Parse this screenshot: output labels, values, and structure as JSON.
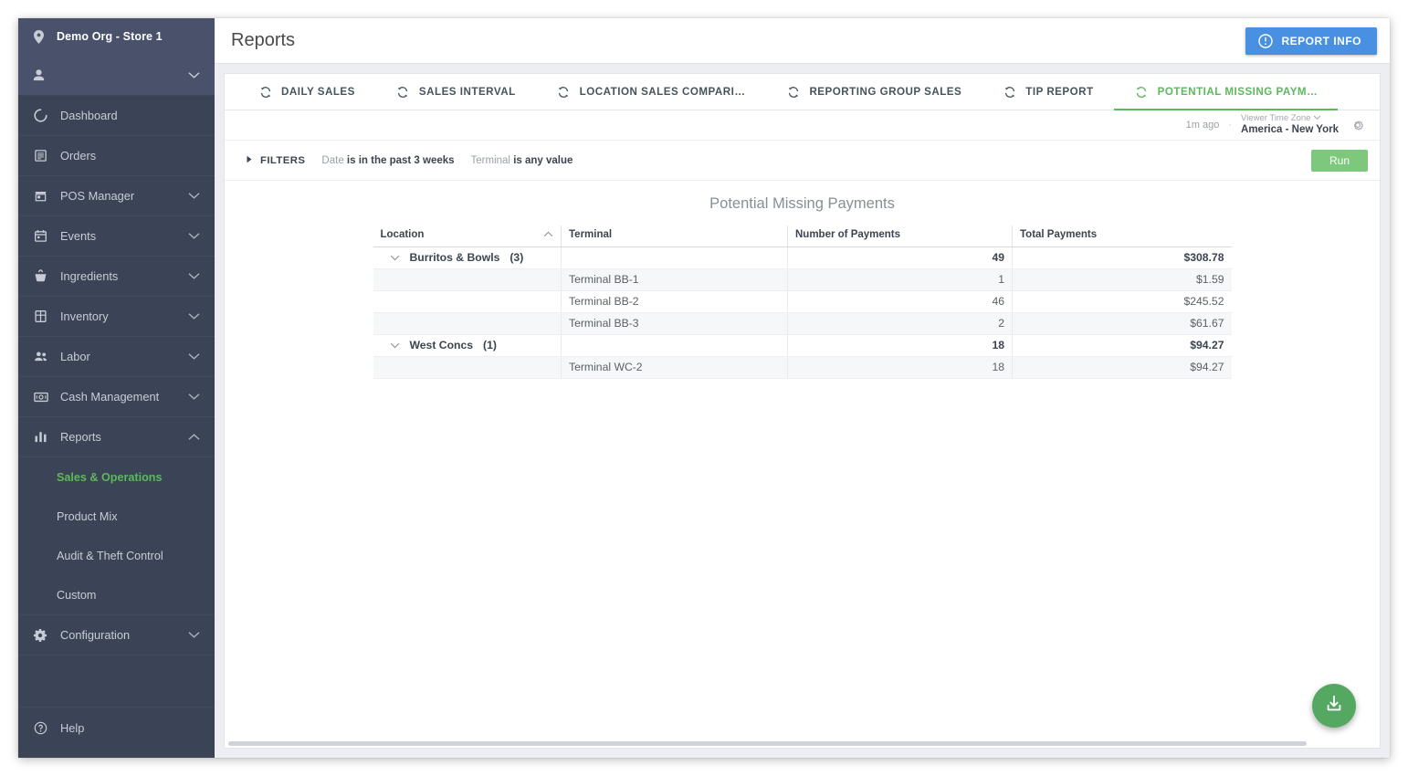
{
  "sidebar": {
    "org_name": "Demo Org - Store 1",
    "items": [
      {
        "label": "Dashboard",
        "icon": "dashboard-icon",
        "expandable": false
      },
      {
        "label": "Orders",
        "icon": "orders-icon",
        "expandable": false
      },
      {
        "label": "POS Manager",
        "icon": "pos-manager-icon",
        "expandable": true
      },
      {
        "label": "Events",
        "icon": "events-calendar-icon",
        "expandable": true
      },
      {
        "label": "Ingredients",
        "icon": "ingredients-icon",
        "expandable": true
      },
      {
        "label": "Inventory",
        "icon": "inventory-icon",
        "expandable": true
      },
      {
        "label": "Labor",
        "icon": "labor-people-icon",
        "expandable": true
      },
      {
        "label": "Cash Management",
        "icon": "cash-icon",
        "expandable": true
      },
      {
        "label": "Reports",
        "icon": "reports-bar-icon",
        "expandable": true,
        "expanded": true
      }
    ],
    "reports_subitems": [
      {
        "label": "Sales & Operations",
        "selected": true
      },
      {
        "label": "Product Mix",
        "selected": false
      },
      {
        "label": "Audit & Theft Control",
        "selected": false
      },
      {
        "label": "Custom",
        "selected": false
      }
    ],
    "configuration": {
      "label": "Configuration",
      "icon": "gear-icon"
    },
    "help": {
      "label": "Help",
      "icon": "help-circle-icon"
    },
    "accent_selected": "#5cb85c",
    "bg_color": "#3b4456",
    "bg_top_color": "#49526a"
  },
  "header": {
    "title": "Reports",
    "report_info_button": "REPORT INFO"
  },
  "tabs": [
    {
      "label": "DAILY SALES",
      "active": false
    },
    {
      "label": "SALES INTERVAL",
      "active": false
    },
    {
      "label": "LOCATION SALES COMPARI…",
      "active": false
    },
    {
      "label": "REPORTING GROUP SALES",
      "active": false
    },
    {
      "label": "TIP REPORT",
      "active": false
    },
    {
      "label": "POTENTIAL MISSING PAYM…",
      "active": true
    }
  ],
  "meta": {
    "last_run": "1m ago",
    "separator": "·",
    "timezone_label": "Viewer Time Zone",
    "timezone_value": "America - New York"
  },
  "filters": {
    "toggle_label": "FILTERS",
    "chips": [
      {
        "field": "Date",
        "condition": "is in the past 3 weeks"
      },
      {
        "field": "Terminal",
        "condition": "is any value"
      }
    ],
    "run_button": "Run"
  },
  "report": {
    "title": "Potential Missing Payments",
    "columns": [
      {
        "label": "Location",
        "align": "left",
        "sorted": true,
        "sort_dir": "asc"
      },
      {
        "label": "Terminal",
        "align": "left",
        "sorted": false
      },
      {
        "label": "Number of Payments",
        "align": "left",
        "sorted": false
      },
      {
        "label": "Total Payments",
        "align": "left",
        "sorted": false
      }
    ],
    "rows": [
      {
        "type": "group",
        "location": "Burritos & Bowls",
        "count": "(3)",
        "terminal": "",
        "number_of_payments": "49",
        "total_payments": "$308.78",
        "stripe": false
      },
      {
        "type": "detail",
        "location": "",
        "terminal": "Terminal BB-1",
        "number_of_payments": "1",
        "total_payments": "$1.59",
        "stripe": true
      },
      {
        "type": "detail",
        "location": "",
        "terminal": "Terminal BB-2",
        "number_of_payments": "46",
        "total_payments": "$245.52",
        "stripe": false
      },
      {
        "type": "detail",
        "location": "",
        "terminal": "Terminal BB-3",
        "number_of_payments": "2",
        "total_payments": "$61.67",
        "stripe": true
      },
      {
        "type": "group",
        "location": "West Concs",
        "count": "(1)",
        "terminal": "",
        "number_of_payments": "18",
        "total_payments": "$94.27",
        "stripe": false
      },
      {
        "type": "detail",
        "location": "",
        "terminal": "Terminal WC-2",
        "number_of_payments": "18",
        "total_payments": "$94.27",
        "stripe": true
      }
    ]
  },
  "fab": {
    "icon": "download-icon"
  },
  "colors": {
    "accent_green": "#5cb85c",
    "run_green": "#7ec87e",
    "fab_green": "#55a861",
    "report_info_blue": "#4a90e2",
    "sidebar_dark": "#3b4456"
  }
}
